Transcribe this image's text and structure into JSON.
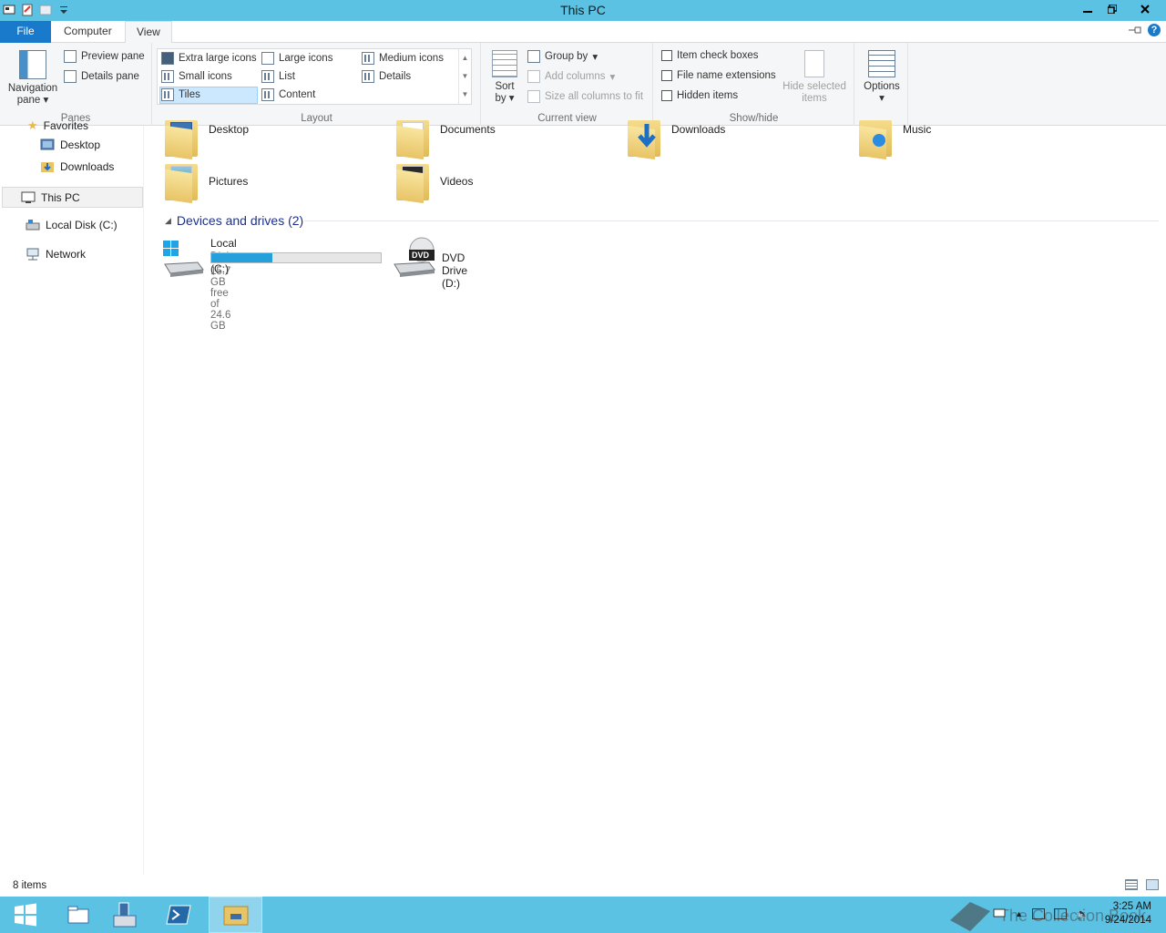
{
  "window": {
    "title": "This PC"
  },
  "ribbon": {
    "tabs": {
      "file": "File",
      "computer": "Computer",
      "view": "View"
    },
    "panes": {
      "navigation_pane": "Navigation",
      "navigation_pane2": "pane",
      "preview_pane": "Preview pane",
      "details_pane": "Details pane",
      "label": "Panes"
    },
    "layout": {
      "extra_large": "Extra large icons",
      "large": "Large icons",
      "medium": "Medium icons",
      "small": "Small icons",
      "list": "List",
      "details": "Details",
      "tiles": "Tiles",
      "content": "Content",
      "label": "Layout",
      "selected": "Tiles"
    },
    "current_view": {
      "sort_by": "Sort",
      "sort_by2": "by",
      "group_by": "Group by",
      "add_columns": "Add columns",
      "size_all": "Size all columns to fit",
      "label": "Current view"
    },
    "show_hide": {
      "item_check_boxes": "Item check boxes",
      "file_name_extensions": "File name extensions",
      "hidden_items": "Hidden items",
      "hide_selected": "Hide selected",
      "hide_selected2": "items",
      "label": "Show/hide"
    },
    "options": {
      "label": "Options"
    }
  },
  "nav": {
    "favorites": "Favorites",
    "desktop": "Desktop",
    "downloads": "Downloads",
    "this_pc": "This PC",
    "local_disk": "Local Disk (C:)",
    "network": "Network"
  },
  "content": {
    "folders": [
      {
        "name": "Desktop"
      },
      {
        "name": "Documents"
      },
      {
        "name": "Downloads"
      },
      {
        "name": "Music"
      },
      {
        "name": "Pictures"
      },
      {
        "name": "Videos"
      }
    ],
    "devices_header": "Devices and drives (2)",
    "drives": [
      {
        "name": "Local Disk (C:)",
        "free": "15.7 GB free of 24.6 GB",
        "used_fraction": 0.36
      },
      {
        "name": "DVD Drive (D:)",
        "badge": "DVD"
      }
    ]
  },
  "status": {
    "item_count": "8 items"
  },
  "taskbar": {
    "time": "3:25 AM",
    "date": "9/24/2014",
    "watermark": "The Collection Book"
  },
  "colors": {
    "titlebar": "#5bc2e3",
    "file_tab": "#1979ca",
    "accent": "#26a0da"
  }
}
